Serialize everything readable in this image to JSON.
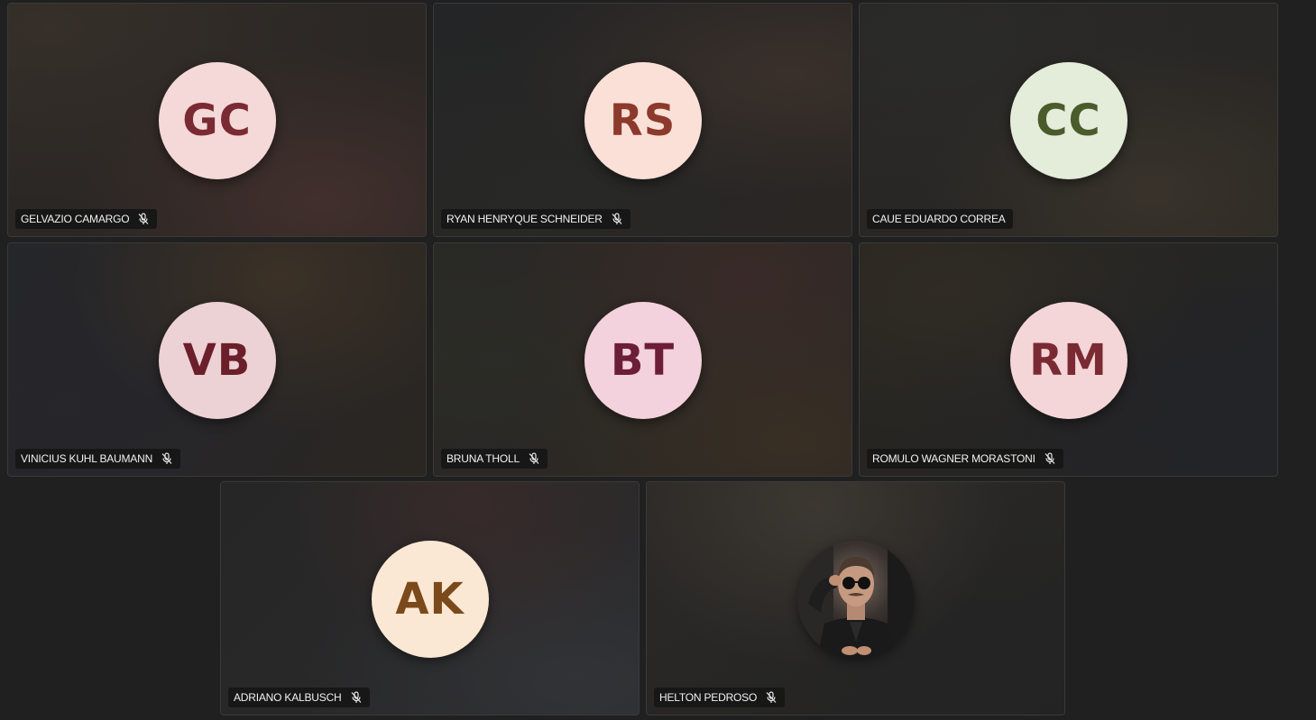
{
  "participants": [
    {
      "initials": "GC",
      "name": "GELVAZIO CAMARGO",
      "muted_icon": "mic-off-icon",
      "avatar_bg": "#f4d9d8",
      "avatar_fg": "#7a2a33"
    },
    {
      "initials": "RS",
      "name": "RYAN HENRYQUE SCHNEIDER",
      "muted_icon": "mic-off-icon",
      "avatar_bg": "#fbe0d8",
      "avatar_fg": "#8b3a2c"
    },
    {
      "initials": "CC",
      "name": "CAUE EDUARDO CORREA",
      "avatar_bg": "#e4ecda",
      "avatar_fg": "#4a5c2c"
    },
    {
      "initials": "VB",
      "name": "VINICIUS KUHL BAUMANN",
      "muted_icon": "mic-off-icon",
      "avatar_bg": "#ecd1d5",
      "avatar_fg": "#6b1f2a"
    },
    {
      "initials": "BT",
      "name": "BRUNA THOLL",
      "muted_icon": "mic-off-icon",
      "avatar_bg": "#f3d1dd",
      "avatar_fg": "#6c1d37"
    },
    {
      "initials": "RM",
      "name": "ROMULO WAGNER MORASTONI",
      "muted_icon": "mic-off-icon",
      "avatar_bg": "#f5d6d8",
      "avatar_fg": "#7a2a33"
    },
    {
      "initials": "AK",
      "name": "ADRIANO KALBUSCH",
      "muted_icon": "mic-off-icon",
      "avatar_bg": "#fbe8d4",
      "avatar_fg": "#7b4a1a"
    },
    {
      "initials": "",
      "name": "HELTON PEDROSO",
      "muted_icon": "mic-off-icon",
      "avatar_type": "photo"
    }
  ]
}
